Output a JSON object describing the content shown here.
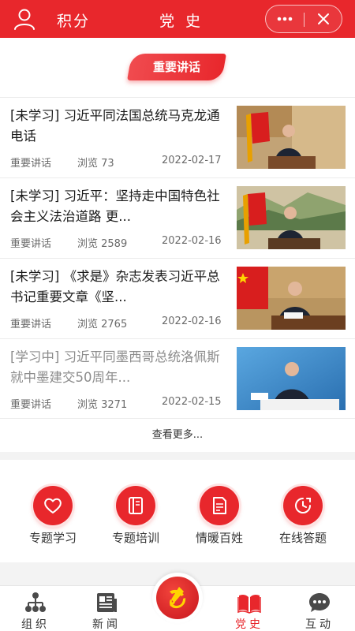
{
  "header": {
    "left_title": "积分",
    "center_title": "党 史",
    "icons": {
      "user": "user-icon",
      "more": "more-dots-icon",
      "close": "close-icon"
    }
  },
  "section": {
    "badge": "重要讲话"
  },
  "news": [
    {
      "title": "[未学习] 习近平同法国总统马克龙通电话",
      "category": "重要讲话",
      "views": "浏览 73",
      "date": "2022-02-17",
      "dim": false
    },
    {
      "title": "[未学习] 习近平：坚持走中国特色社会主义法治道路 更...",
      "category": "重要讲话",
      "views": "浏览 2589",
      "date": "2022-02-16",
      "dim": false
    },
    {
      "title": "[未学习] 《求是》杂志发表习近平总书记重要文章《坚...",
      "category": "重要讲话",
      "views": "浏览 2765",
      "date": "2022-02-16",
      "dim": false
    },
    {
      "title": "[学习中] 习近平同墨西哥总统洛佩斯就中墨建交50周年...",
      "category": "重要讲话",
      "views": "浏览 3271",
      "date": "2022-02-15",
      "dim": true
    }
  ],
  "see_more": "查看更多...",
  "features": [
    {
      "label": "专题学习",
      "icon": "heart-icon"
    },
    {
      "label": "专题培训",
      "icon": "book-icon"
    },
    {
      "label": "情暖百姓",
      "icon": "document-icon"
    },
    {
      "label": "在线答题",
      "icon": "clock-icon"
    }
  ],
  "tabs": [
    {
      "label": "组织",
      "icon": "org-chart-icon",
      "active": false
    },
    {
      "label": "新闻",
      "icon": "newspaper-icon",
      "active": false
    },
    {
      "label": "党史",
      "icon": "open-book-icon",
      "active": true
    },
    {
      "label": "互动",
      "icon": "chat-bubble-icon",
      "active": false
    }
  ],
  "center_tab_icon": "party-emblem-icon",
  "colors": {
    "brand_red": "#e8272c",
    "text": "#1a1a1a",
    "muted": "#6a6a6a"
  }
}
